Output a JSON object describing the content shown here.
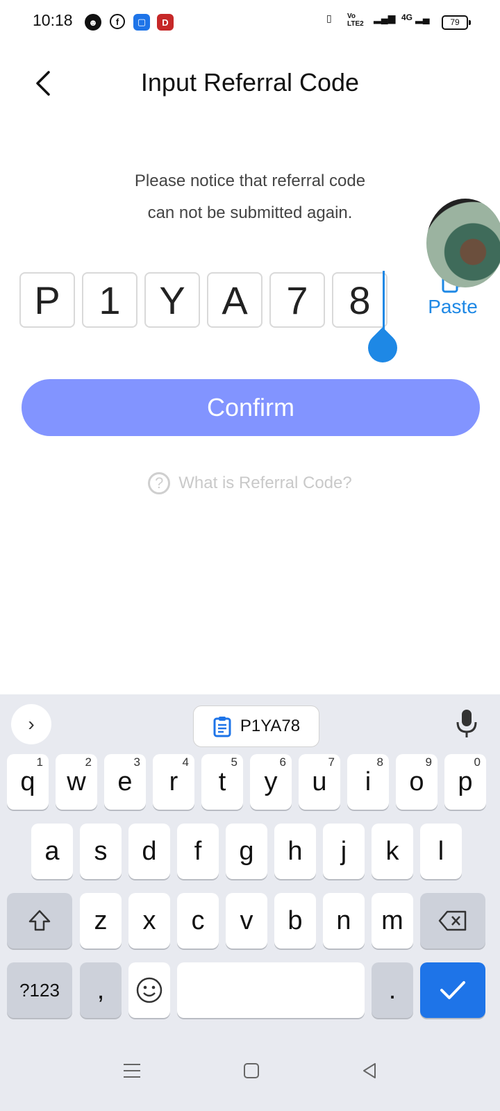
{
  "status_bar": {
    "time": "10:18",
    "signal_labels": {
      "volte": "Vo LTE2",
      "network": "4G"
    },
    "battery": "79"
  },
  "header": {
    "title": "Input Referral Code"
  },
  "notice": {
    "line1": "Please notice that referral code",
    "line2": "can not be submitted again."
  },
  "code": [
    "P",
    "1",
    "Y",
    "A",
    "7",
    "8"
  ],
  "paste_label": "Paste",
  "confirm_label": "Confirm",
  "help": {
    "icon_text": "?",
    "label": "What is Referral Code?"
  },
  "keyboard": {
    "clipboard_suggestion": "P1YA78",
    "row1": [
      {
        "k": "q",
        "n": "1"
      },
      {
        "k": "w",
        "n": "2"
      },
      {
        "k": "e",
        "n": "3"
      },
      {
        "k": "r",
        "n": "4"
      },
      {
        "k": "t",
        "n": "5"
      },
      {
        "k": "y",
        "n": "6"
      },
      {
        "k": "u",
        "n": "7"
      },
      {
        "k": "i",
        "n": "8"
      },
      {
        "k": "o",
        "n": "9"
      },
      {
        "k": "p",
        "n": "0"
      }
    ],
    "row2": [
      "a",
      "s",
      "d",
      "f",
      "g",
      "h",
      "j",
      "k",
      "l"
    ],
    "row3": [
      "z",
      "x",
      "c",
      "v",
      "b",
      "n",
      "m"
    ],
    "sym_label": "?123",
    "comma_label": ",",
    "period_label": "."
  },
  "colors": {
    "accent": "#1e88e5",
    "confirm_bg": "#8294ff",
    "enter_key": "#1e74e8"
  }
}
